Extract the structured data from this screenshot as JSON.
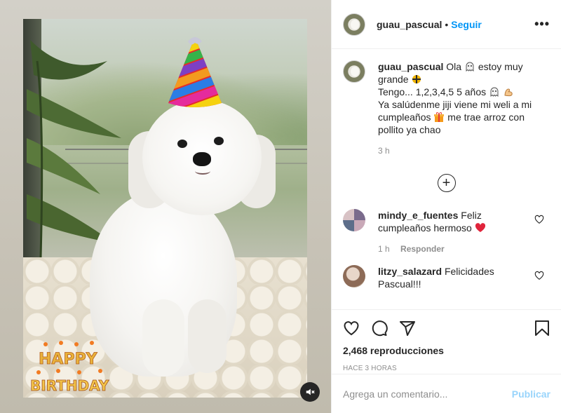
{
  "post": {
    "author": "guau_pascual",
    "dot": "•",
    "follow_label": "Seguir",
    "more_label": "•••",
    "caption": {
      "line1_text": "Ola",
      "line1_tail": "estoy muy grande",
      "line2_text": "Tengo... 1,2,3,4,5 5 años",
      "line3_text": "Ya salúdenme jiji viene mi weli a mi cumpleaños",
      "line3_tail": "me trae arroz con pollito ya chao",
      "time": "3 h"
    },
    "load_more_label": "+",
    "comments": [
      {
        "username": "mindy_e_fuentes",
        "text": "Feliz cumpleaños hermoso",
        "time": "1 h",
        "reply_label": "Responder"
      },
      {
        "username": "litzy_salazard",
        "text": "Felicidades Pascual!!!"
      }
    ],
    "views": "2,468 reproducciones",
    "posted": "HACE 3 HORAS",
    "add_comment": {
      "placeholder": "Agrega un comentario...",
      "publish_label": "Publicar"
    },
    "photo_overlay": {
      "line1": "HAPPY",
      "line2": "BIRTHDAY"
    }
  },
  "colors": {
    "accent": "#0095f6",
    "text": "#262626",
    "secondary": "#8e8e8e",
    "divider": "#efefef",
    "heart": "#ed4956"
  },
  "icons": [
    "mute-icon",
    "more-icon",
    "heart-icon",
    "comment-icon",
    "share-icon",
    "save-icon",
    "add-circle-icon"
  ]
}
